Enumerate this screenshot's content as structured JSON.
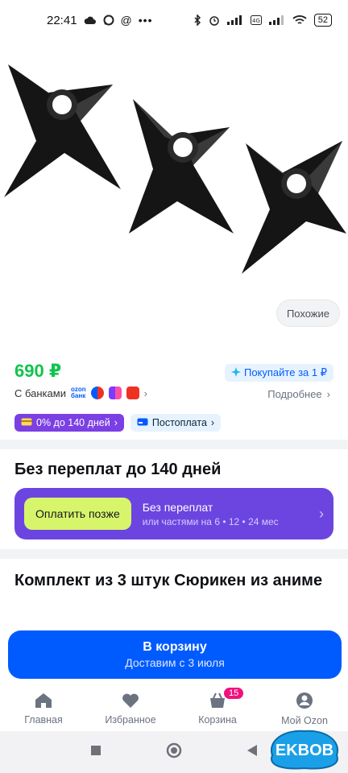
{
  "status_bar": {
    "time": "22:41",
    "battery": "52"
  },
  "gallery": {
    "similar_label": "Похожие"
  },
  "price_block": {
    "price": "690 ₽",
    "buy_for_label": "Покупайте за 1 ₽",
    "with_banks_label": "С банками",
    "ozon_bank_line1": "ozon",
    "ozon_bank_line2": "банк",
    "more_label": "Подробнее",
    "installment_chip": "0% до 140 дней",
    "postpay_chip": "Постоплата"
  },
  "installment": {
    "title": "Без переплат до 140 дней",
    "pay_later_label": "Оплатить позже",
    "no_overpay_title": "Без переплат",
    "no_overpay_sub": "или частями на 6 • 12 • 24 мес"
  },
  "product": {
    "title": "Комплект из 3 штук Сюрикен из аниме"
  },
  "cart_button": {
    "label": "В корзину",
    "delivery": "Доставим с 3 июля"
  },
  "bottom_nav": {
    "items": [
      {
        "label": "Главная",
        "icon": "home-icon"
      },
      {
        "label": "Избранное",
        "icon": "heart-icon"
      },
      {
        "label": "Корзина",
        "icon": "basket-icon",
        "badge": "15"
      },
      {
        "label": "Мой Ozon",
        "icon": "profile-icon"
      }
    ]
  },
  "watermark": {
    "text": "EKBOB"
  },
  "colors": {
    "brand_blue": "#005bff",
    "price_green": "#10c44c",
    "bnpl_purple": "#6c45e0",
    "badge_pink": "#f1117e"
  }
}
